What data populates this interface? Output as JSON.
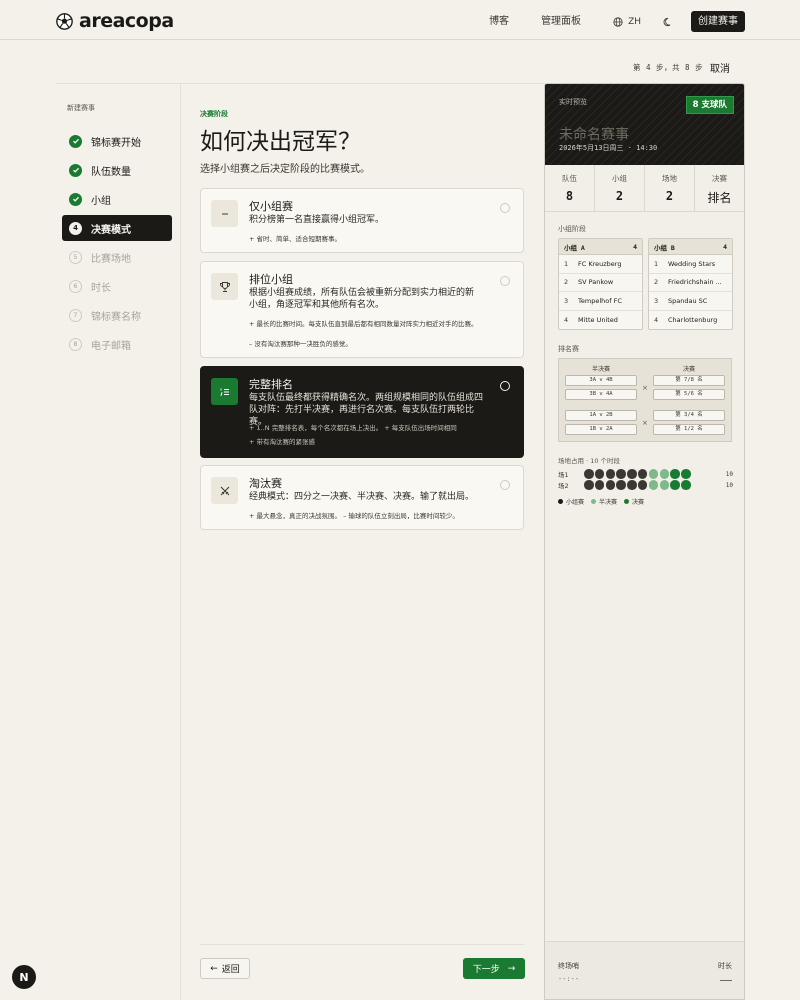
{
  "brand": {
    "name": "areacopa"
  },
  "nav": {
    "blog": "博客",
    "dashboard": "管理面板",
    "lang": "ZH",
    "create": "创建赛事"
  },
  "progress": {
    "step_text": "第 4 步，共 8 步",
    "cancel": "取消",
    "current": 4,
    "total": 8
  },
  "sidebar": {
    "title": "新建赛事",
    "steps": [
      {
        "num": "1",
        "label": "锦标赛开始",
        "state": "done"
      },
      {
        "num": "2",
        "label": "队伍数量",
        "state": "done"
      },
      {
        "num": "3",
        "label": "小组",
        "state": "done"
      },
      {
        "num": "4",
        "label": "决赛模式",
        "state": "active"
      },
      {
        "num": "5",
        "label": "比赛场地",
        "state": "todo"
      },
      {
        "num": "6",
        "label": "时长",
        "state": "todo"
      },
      {
        "num": "7",
        "label": "锦标赛名称",
        "state": "todo"
      },
      {
        "num": "8",
        "label": "电子邮箱",
        "state": "todo"
      }
    ]
  },
  "main": {
    "eyebrow": "决赛阶段",
    "title": "如何决出冠军？",
    "subtitle": "选择小组赛之后决定阶段的比赛模式。",
    "options": [
      {
        "title": "仅小组赛",
        "desc": "积分榜第一名直接赢得小组冠军。",
        "bullets": [
          "+ 省时、简单、适合短期赛事。"
        ],
        "icon": "dash-icon"
      },
      {
        "title": "排位小组",
        "desc": "根据小组赛成绩，所有队伍会被重新分配到实力相近的新小组，角逐冠军和其他所有名次。",
        "bullets": [
          "+ 最长的比赛时间。每支队伍直到最后都有相同数量对阵实力相近对手的比赛。",
          "– 没有淘汰赛那种一决胜负的感觉。"
        ],
        "icon": "trophy-icon"
      },
      {
        "title": "完整排名",
        "desc": "每支队伍最终都获得精确名次。两组规模相同的队伍组成四队对阵：先打半决赛，再进行名次赛。每支队伍打两轮比赛。",
        "bullets": [
          "+ 1..N 完整排名表，每个名次都在场上决出。    + 每支队伍出场时间相同",
          "+ 带有淘汰赛的紧张感"
        ],
        "icon": "ranking-icon"
      },
      {
        "title": "淘汰赛",
        "desc": "经典模式：四分之一决赛、半决赛、决赛。输了就出局。",
        "bullets": [
          "+ 最大悬念，真正的决战氛围。   – 输球的队伍立刻出局，比赛时间较少。"
        ],
        "icon": "swords-icon"
      }
    ],
    "selected_index": 2,
    "back": "返回",
    "next": "下一步"
  },
  "preview": {
    "eyebrow": "实时预览",
    "badge": "8 支球队",
    "name": "未命名赛事",
    "date": "2026年5月13日周三 · 14:30",
    "stats": [
      {
        "k": "队伍",
        "v": "8"
      },
      {
        "k": "小组",
        "v": "2"
      },
      {
        "k": "场地",
        "v": "2"
      },
      {
        "k": "决赛",
        "v": "排名"
      }
    ],
    "groups_label": "小组阶段",
    "groups": [
      {
        "name": "小组 A",
        "count": "4",
        "teams": [
          "FC Kreuzberg",
          "SV Pankow",
          "Tempelhof FC",
          "Mitte United"
        ]
      },
      {
        "name": "小组 B",
        "count": "4",
        "teams": [
          "Wedding Stars",
          "Friedrichshain ...",
          "Spandau SC",
          "Charlottenburg"
        ]
      }
    ],
    "ranking_label": "排名赛",
    "bracket": {
      "semi_label": "半决赛",
      "final_label": "决赛",
      "semis": [
        "3A v 4B",
        "3B v 4A",
        "1A v 2B",
        "1B v 2A"
      ],
      "finals": [
        "第 7/8 名",
        "第 5/6 名",
        "第 3/4 名",
        "第 1/2 名"
      ]
    },
    "venue_label": "场地占用 · 10 个时段",
    "venues": [
      {
        "name": "场1",
        "slots": [
          "g",
          "g",
          "g",
          "g",
          "g",
          "g",
          "s",
          "s",
          "f",
          "f"
        ],
        "count": "10"
      },
      {
        "name": "场2",
        "slots": [
          "g",
          "g",
          "g",
          "g",
          "g",
          "g",
          "s",
          "s",
          "f",
          "f"
        ],
        "count": "10"
      }
    ],
    "legend": [
      {
        "label": "小组赛",
        "color": "#1c1a17"
      },
      {
        "label": "半决赛",
        "color": "#7fb98a"
      },
      {
        "label": "决赛",
        "color": "#1a7a31"
      }
    ],
    "footer": {
      "end_label": "终场哨",
      "end_value": "--:--",
      "duration_label": "时长"
    }
  },
  "colors": {
    "accent": "#1a7a31",
    "dark": "#1c1a17",
    "background": "#f4f1ea"
  }
}
